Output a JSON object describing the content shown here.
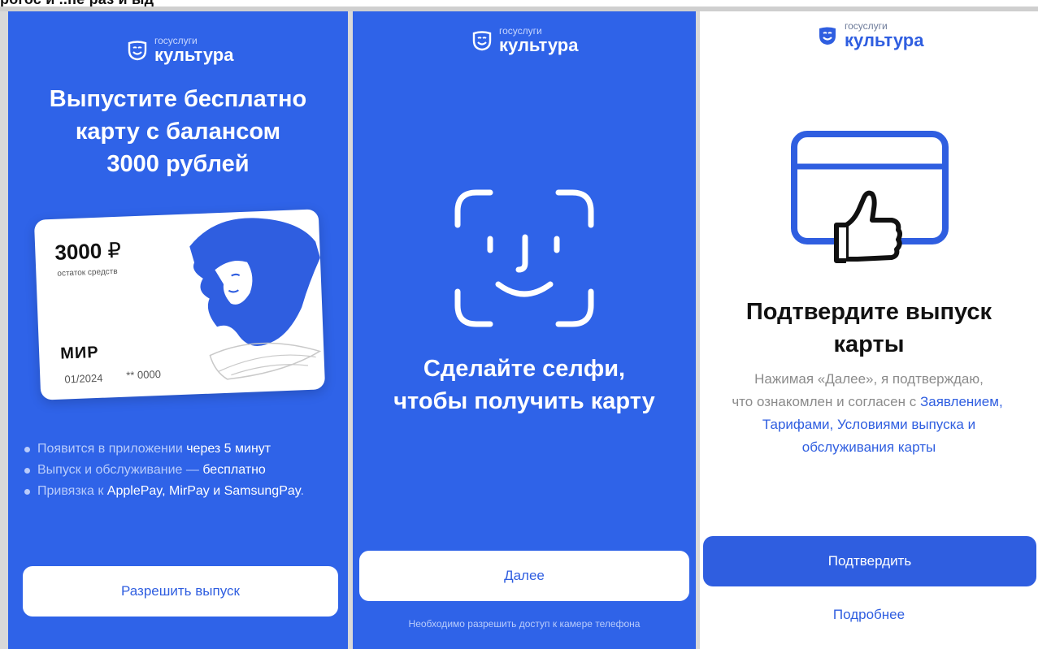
{
  "header_fragment": "рогос и ..пе  раз  и ыд",
  "logo": {
    "small": "госуслуги",
    "big": "культура"
  },
  "panel1": {
    "headline": [
      "Выпустите бесплатно",
      "карту с балансом",
      "3000 рублей"
    ],
    "card": {
      "amount": "3000",
      "currency": "₽",
      "subtitle": "остаток средств",
      "brand": "МИР",
      "date": "01/2024",
      "number": "** 0000"
    },
    "bullets": [
      {
        "text": "Появится в приложении ",
        "bold": "через 5 минут"
      },
      {
        "text": "Выпуск и обслуживание — ",
        "bold": "бесплатно"
      },
      {
        "text": "Привязка к ",
        "bold": "ApplePay, MirPay и SamsungPay",
        "tail": "."
      }
    ],
    "button": "Разрешить выпуск"
  },
  "panel2": {
    "headline": [
      "Сделайте селфи,",
      "чтобы получить карту"
    ],
    "button": "Далее",
    "hint": "Необходимо разрешить доступ к камере телефона"
  },
  "panel3": {
    "title": [
      "Подтвердите выпуск",
      "карты"
    ],
    "terms": {
      "line1": "Нажимая «Далее», я подтверждаю,",
      "line2_text": "что ознакомлен и согласен с ",
      "line2_link": "Заявлением,",
      "line3_link": "Тарифами, Условиями выпуска и",
      "line4_link": "обслуживания карты"
    },
    "button": "Подтвердить",
    "more": "Подробнее"
  },
  "colors": {
    "brand_blue": "#2f63e8",
    "link_blue": "#2f5ee0",
    "bullet_text": "#b9ccfb"
  },
  "icons": {
    "logo": "theater-mask-icon",
    "face_scan": "face-id-icon",
    "card_like": "card-thumbs-up-icon"
  }
}
